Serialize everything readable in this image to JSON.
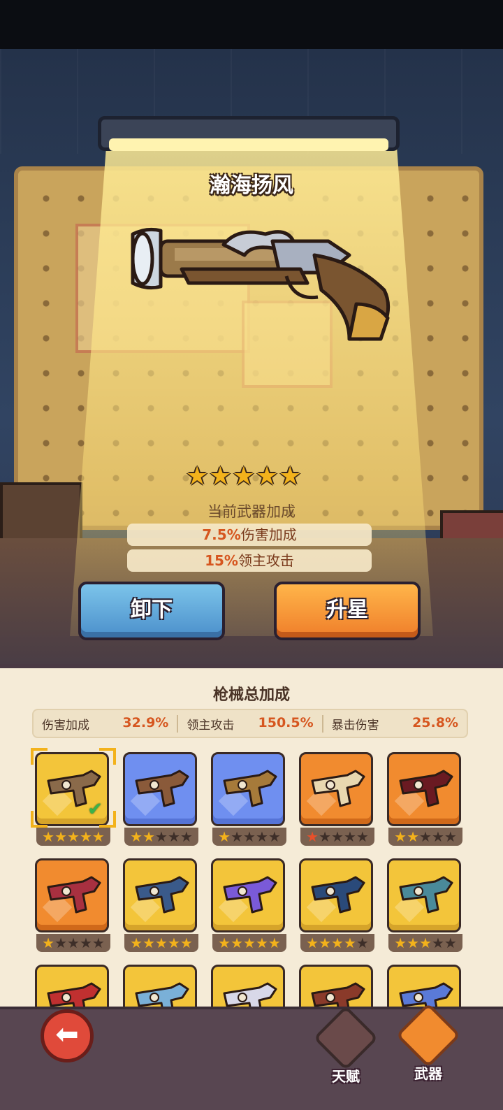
{
  "weapon": {
    "name": "瀚海扬风",
    "stars": 5,
    "bonus_heading": "当前武器加成",
    "bonuses": [
      {
        "value": "7.5%",
        "label": "伤害加成"
      },
      {
        "value": "15%",
        "label": "领主攻击"
      }
    ]
  },
  "buttons": {
    "unequip": "卸下",
    "upgrade": "升星"
  },
  "panel": {
    "title": "枪械总加成",
    "stats": [
      {
        "label": "伤害加成",
        "value": "32.9%"
      },
      {
        "label": "领主攻击",
        "value": "150.5%"
      },
      {
        "label": "暴击伤害",
        "value": "25.8%"
      }
    ]
  },
  "weapons_grid": [
    {
      "rarity": "yellow",
      "stars": 5,
      "red": 0,
      "selected": true,
      "icon": "flintlock-pistol-icon",
      "color": "#8a6a4a"
    },
    {
      "rarity": "blue",
      "stars": 2,
      "red": 0,
      "selected": false,
      "icon": "crossbow-pistol-icon",
      "color": "#8a5a3a"
    },
    {
      "rarity": "blue",
      "stars": 1,
      "red": 0,
      "selected": false,
      "icon": "key-blaster-icon",
      "color": "#a67a3a"
    },
    {
      "rarity": "orange",
      "stars": 0,
      "red": 1,
      "selected": false,
      "icon": "bone-cannon-icon",
      "color": "#e8d8b0"
    },
    {
      "rarity": "orange",
      "stars": 2,
      "red": 0,
      "selected": false,
      "icon": "demon-rifle-icon",
      "color": "#6a1a22"
    },
    {
      "rarity": "orange",
      "stars": 1,
      "red": 0,
      "selected": false,
      "icon": "dragon-shotgun-icon",
      "color": "#a83040"
    },
    {
      "rarity": "yellow",
      "stars": 5,
      "red": 0,
      "selected": false,
      "icon": "candy-launcher-icon",
      "color": "#3a5a8a"
    },
    {
      "rarity": "yellow",
      "stars": 5,
      "red": 0,
      "selected": false,
      "icon": "crystal-blaster-icon",
      "color": "#7a5ad8"
    },
    {
      "rarity": "yellow",
      "stars": 4,
      "red": 0,
      "selected": false,
      "icon": "plasma-rifle-icon",
      "color": "#2a4a7a"
    },
    {
      "rarity": "yellow",
      "stars": 3,
      "red": 0,
      "selected": false,
      "icon": "wrench-gun-icon",
      "color": "#4a8a9a"
    },
    {
      "rarity": "yellow",
      "stars": 0,
      "red": 0,
      "selected": false,
      "icon": "mech-gauntlet-icon",
      "color": "#c03030"
    },
    {
      "rarity": "yellow",
      "stars": 0,
      "red": 0,
      "selected": false,
      "icon": "golden-blaster-icon",
      "color": "#7ab0d8"
    },
    {
      "rarity": "yellow",
      "stars": 0,
      "red": 0,
      "selected": false,
      "icon": "blade-gun-icon",
      "color": "#d8d8e8"
    },
    {
      "rarity": "yellow",
      "stars": 0,
      "red": 0,
      "selected": false,
      "icon": "wooden-musket-icon",
      "color": "#8a3a2a"
    },
    {
      "rarity": "yellow",
      "stars": 0,
      "red": 0,
      "selected": false,
      "icon": "flower-cannon-icon",
      "color": "#5a7ad8"
    }
  ],
  "footer": {
    "back_icon": "back-arrow-icon",
    "tabs": [
      {
        "label": "天赋",
        "active": false
      },
      {
        "label": "武器",
        "active": true
      }
    ]
  }
}
